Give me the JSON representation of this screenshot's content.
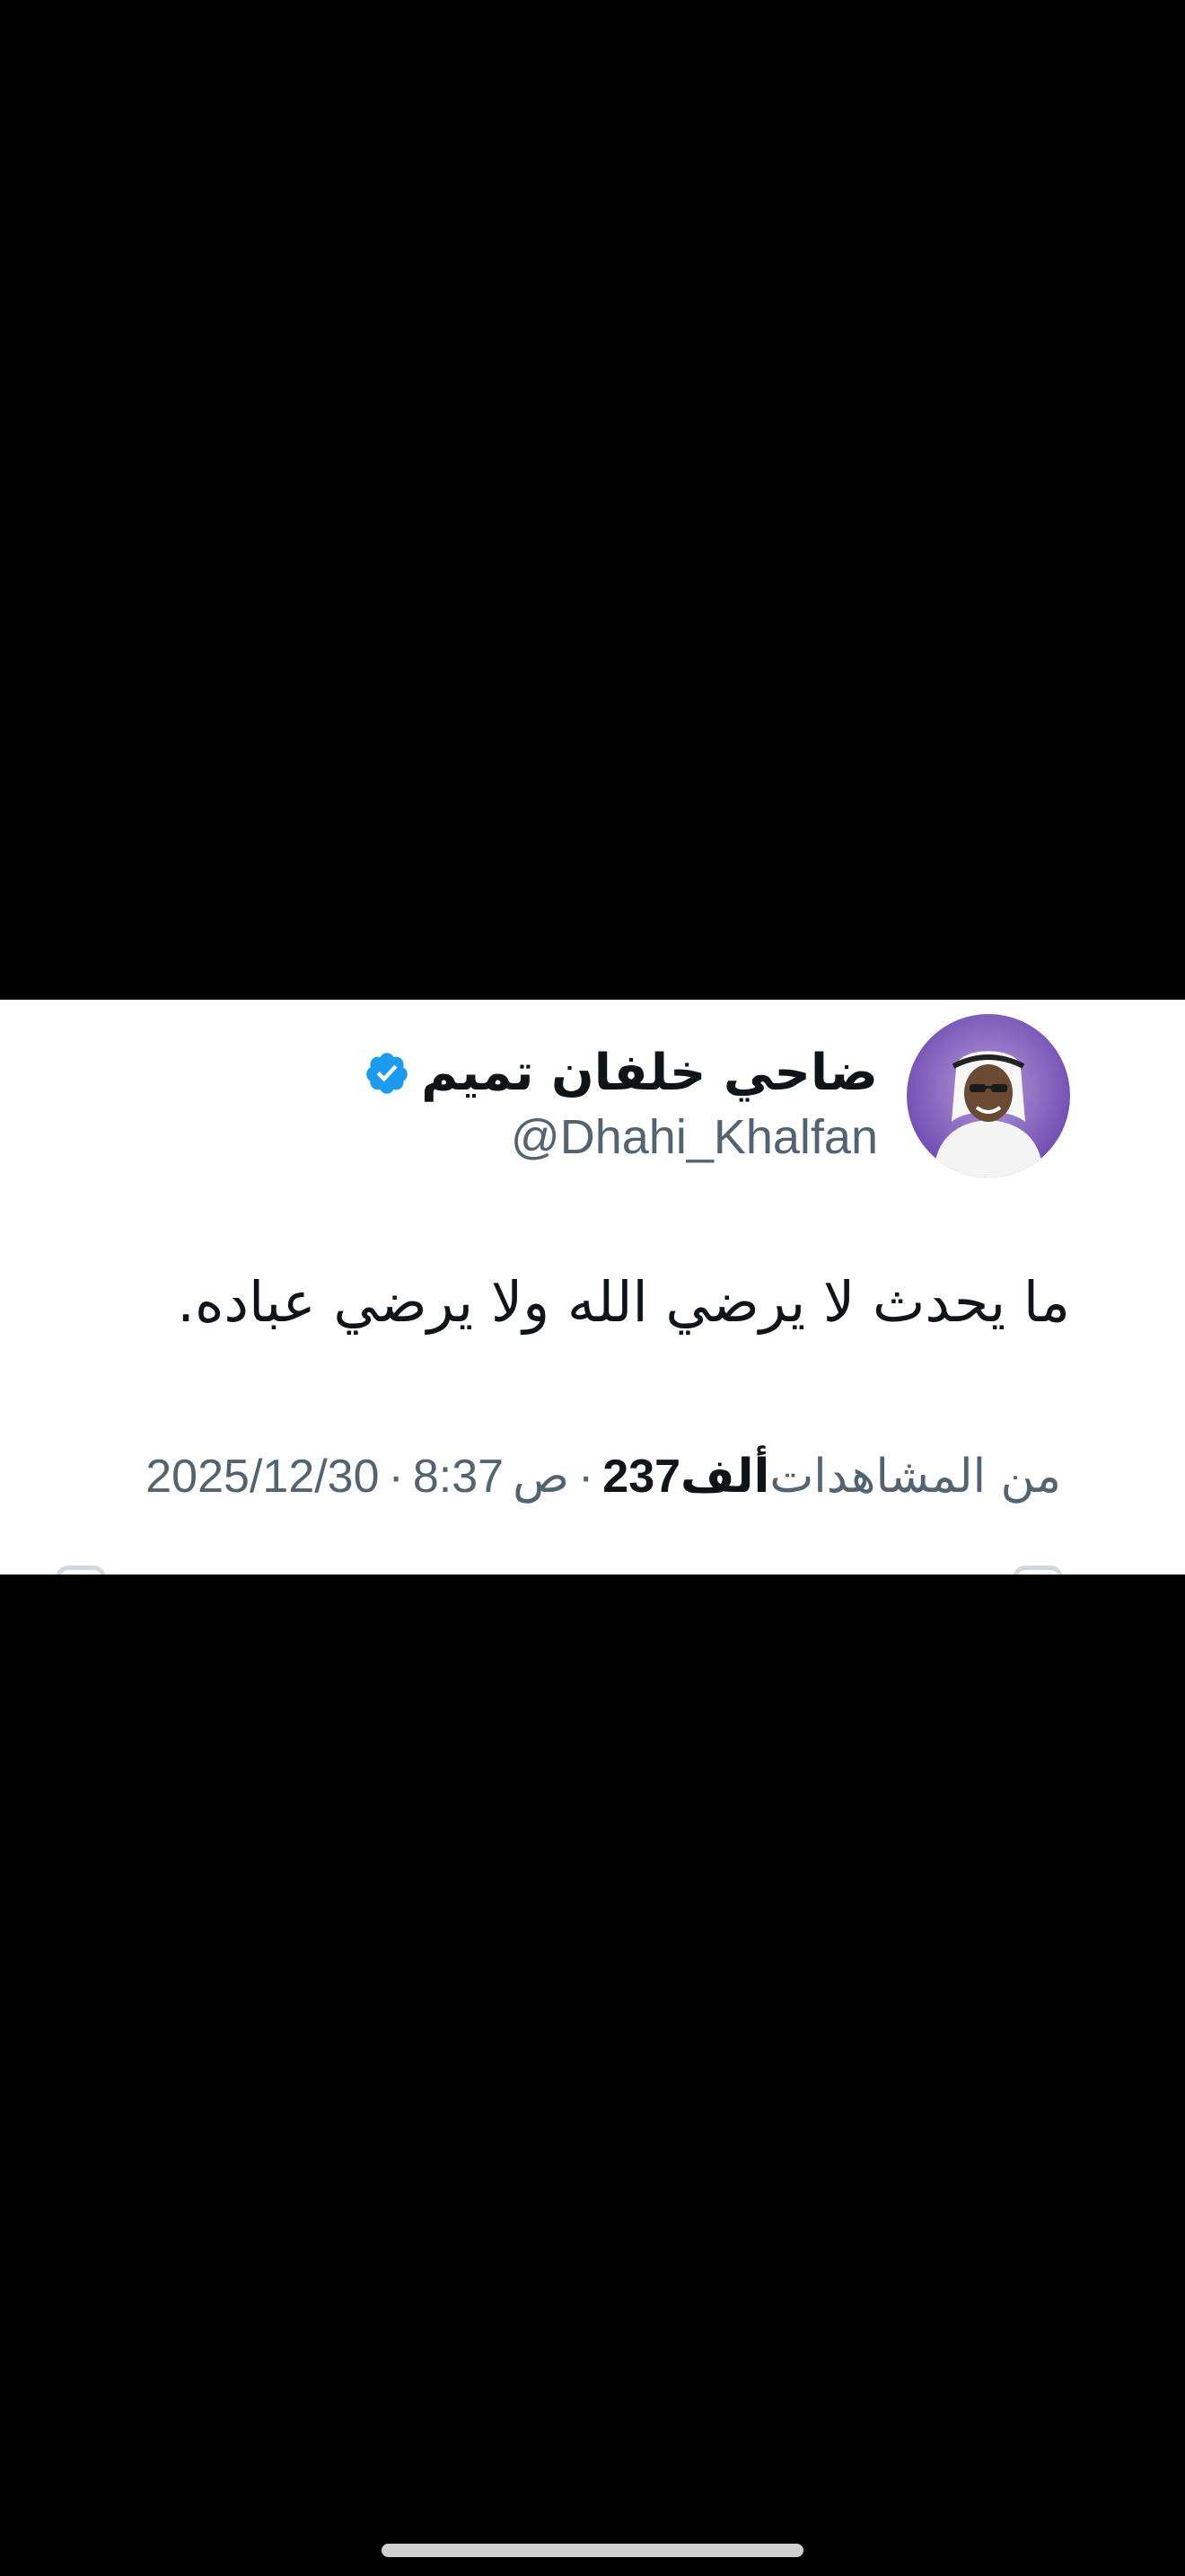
{
  "tweet": {
    "display_name": "ضاحي خلفان تميم",
    "handle": "@Dhahi_Khalfan",
    "text": "ما يحدث لا يرضي الله ولا يرضي عباده.",
    "date": "2025/12/30",
    "time": "8:37",
    "time_suffix": "ص",
    "views_count": "237",
    "views_unit": "ألف",
    "views_label": "من المشاهدات",
    "separator": "·"
  },
  "icons": {
    "verified": "verified-badge-icon",
    "avatar": "profile-avatar"
  },
  "colors": {
    "background": "#000000",
    "card": "#ffffff",
    "primary_text": "#0f1419",
    "secondary_text": "#536471",
    "verified_blue": "#1d9bf0"
  }
}
